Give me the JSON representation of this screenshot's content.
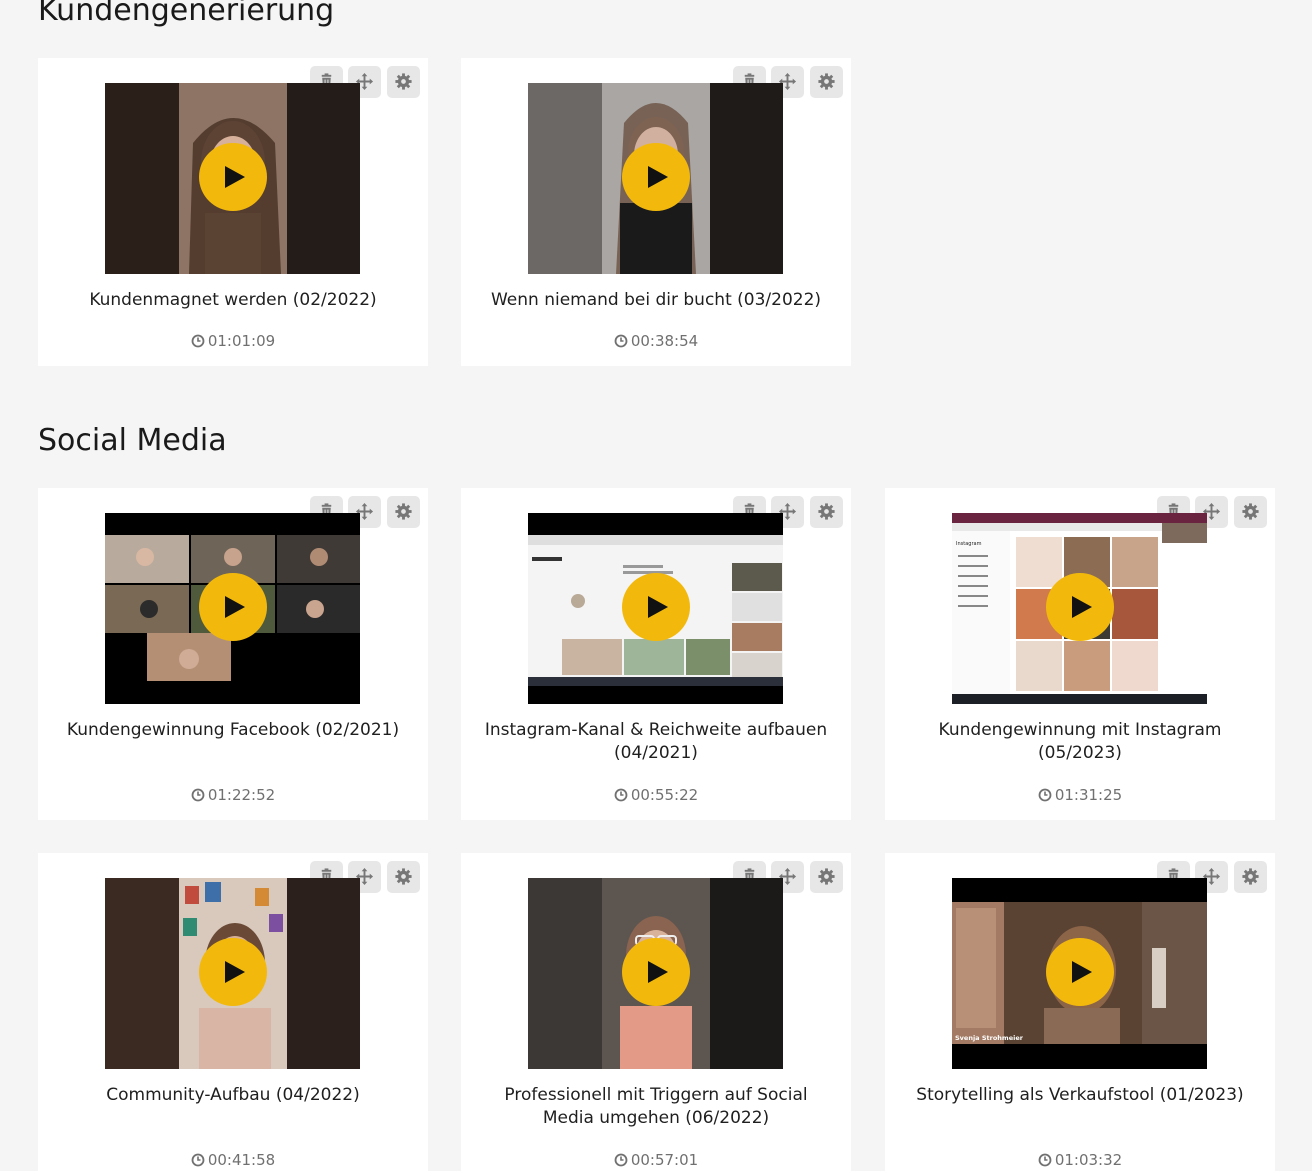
{
  "sections": [
    {
      "title": "Kundengenerierung",
      "videos": [
        {
          "title": "Kundenmagnet werden (02/2022)",
          "duration": "01:01:09"
        },
        {
          "title": "Wenn niemand bei dir bucht (03/2022)",
          "duration": "00:38:54"
        }
      ]
    },
    {
      "title": "Social Media",
      "videos": [
        {
          "title": "Kundengewinnung Facebook (02/2021)",
          "duration": "01:22:52"
        },
        {
          "title": "Instagram-Kanal & Reichweite aufbauen (04/2021)",
          "duration": "00:55:22"
        },
        {
          "title": "Kundengewinnung mit Instagram (05/2023)",
          "duration": "01:31:25"
        },
        {
          "title": "Community-Aufbau (04/2022)",
          "duration": "00:41:58"
        },
        {
          "title": "Professionell mit Triggern auf Social Media umgehen (06/2022)",
          "duration": "00:57:01"
        },
        {
          "title": "Storytelling als Verkaufstool (01/2023)",
          "duration": "01:03:32"
        }
      ]
    }
  ],
  "icons": {
    "delete": "trash-icon",
    "move": "move-arrows-icon",
    "settings": "gear-icon",
    "play": "play-icon",
    "duration": "clock-icon"
  },
  "colors": {
    "background": "#f5f5f5",
    "card": "#ffffff",
    "play_button": "#f2b90c",
    "tool_button": "#e7e7e7",
    "tool_icon": "#777777",
    "meta_text": "#707070"
  },
  "thumbnail_texts": {
    "instagram_brand": "Instagram",
    "speaker_name": "Svenja Strohmeier"
  }
}
